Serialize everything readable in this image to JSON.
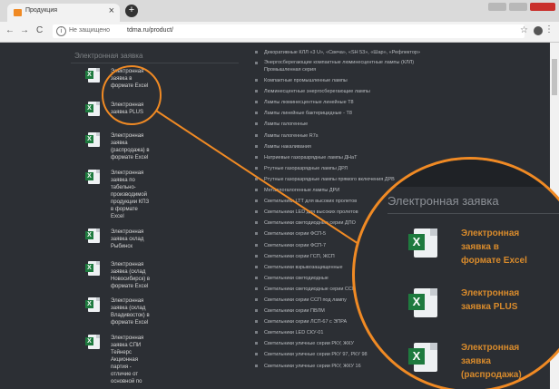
{
  "browser": {
    "tab_title": "Продукция",
    "close_glyph": "×",
    "new_tab_glyph": "+",
    "back_glyph": "←",
    "forward_glyph": "→",
    "reload_glyph": "C",
    "info_glyph": "i",
    "security_text": "Не защищено",
    "url": "tdma.ru/product/",
    "star_glyph": "☆",
    "menu_glyph": "⋮"
  },
  "sidebar": {
    "heading": "Электронная заявка",
    "items": [
      {
        "label": "Электронная\nзаявка в\nформате Excel"
      },
      {
        "label": "Электронная\nзаявка PLUS"
      },
      {
        "label": "Электронная\nзаявка\n(распродажа) в\nформате Excel"
      },
      {
        "label": "Электронная\nзаявка по\nтабельно-\nпроизводимой\nпродукции КПЗ\nв формате\nExcel"
      },
      {
        "label": "Электронная\nзаявка склад\nРыбинск"
      },
      {
        "label": "Электронная\nзаявка (склад\nНовосибирск) в\nформате Excel"
      },
      {
        "label": "Электронная\nзаявка (склад\nВладивосток) в\nформате Excel"
      },
      {
        "label": "Электронная\nзаявка СПИ\nТейнерс\nАкционная\nпартия -\nотличие от\nосновной по"
      }
    ]
  },
  "products": [
    "Декоративные КЛЛ «3 U», «Свеча», «SH 53», «Шар», «Рефлектор»",
    "Энергосберегающие компактные люминесцентные лампы (КЛЛ) Промышленная серия",
    "Компактные промышленные лампы",
    "Люминесцентные энергосберегающие лампы",
    "Лампы люминесцентные линейные Т8",
    "Лампы линейные бактерицидные - Т8",
    "Лампы галогенные",
    "Лампы галогенные R7s",
    "Лампы накаливания",
    "Натриевые газоразрядные лампы ДНаТ",
    "Ртутные газоразрядные лампы ДРЛ",
    "Ртутные газоразрядные лампы прямого включения ДРВ",
    "Металлогалогенные лампы ДРИ",
    "Светильники LTT для высоких пролетов",
    "Светильники LED для высоких пролетов",
    "Светильники светодиодные серии ДПО",
    "Светильники серии ФСП-5",
    "Светильники серии ФСП-7",
    "Светильники серии ГСП, ЖСП",
    "Светильники взрывозащищенные",
    "Светильники светодиодные",
    "Светильники светодиодные серии ССП",
    "Светильники серии ССП под лампу",
    "Светильники серии ПВЛМ",
    "Светильники серии ЛСП-67 с ЭПРА",
    "Светильники LED СКУ-01",
    "Светильники уличные серии РКУ, ЖКУ",
    "Светильники уличные серии РКУ 97, РКУ 98",
    "Светильники уличные серии РКУ, ЖКУ 16"
  ],
  "zoom": {
    "heading": "Электронная заявка",
    "items": [
      {
        "label": "Электронная\nзаявка в\nформате Excel"
      },
      {
        "label": "Электронная\nзаявка PLUS"
      },
      {
        "label": "Электронная\nзаявка\n(распродажа)"
      }
    ]
  },
  "colors": {
    "accent": "#f08a24",
    "link": "#d98b2c",
    "background": "#2c2f34"
  },
  "icons": {
    "file": "excel-file-icon"
  }
}
